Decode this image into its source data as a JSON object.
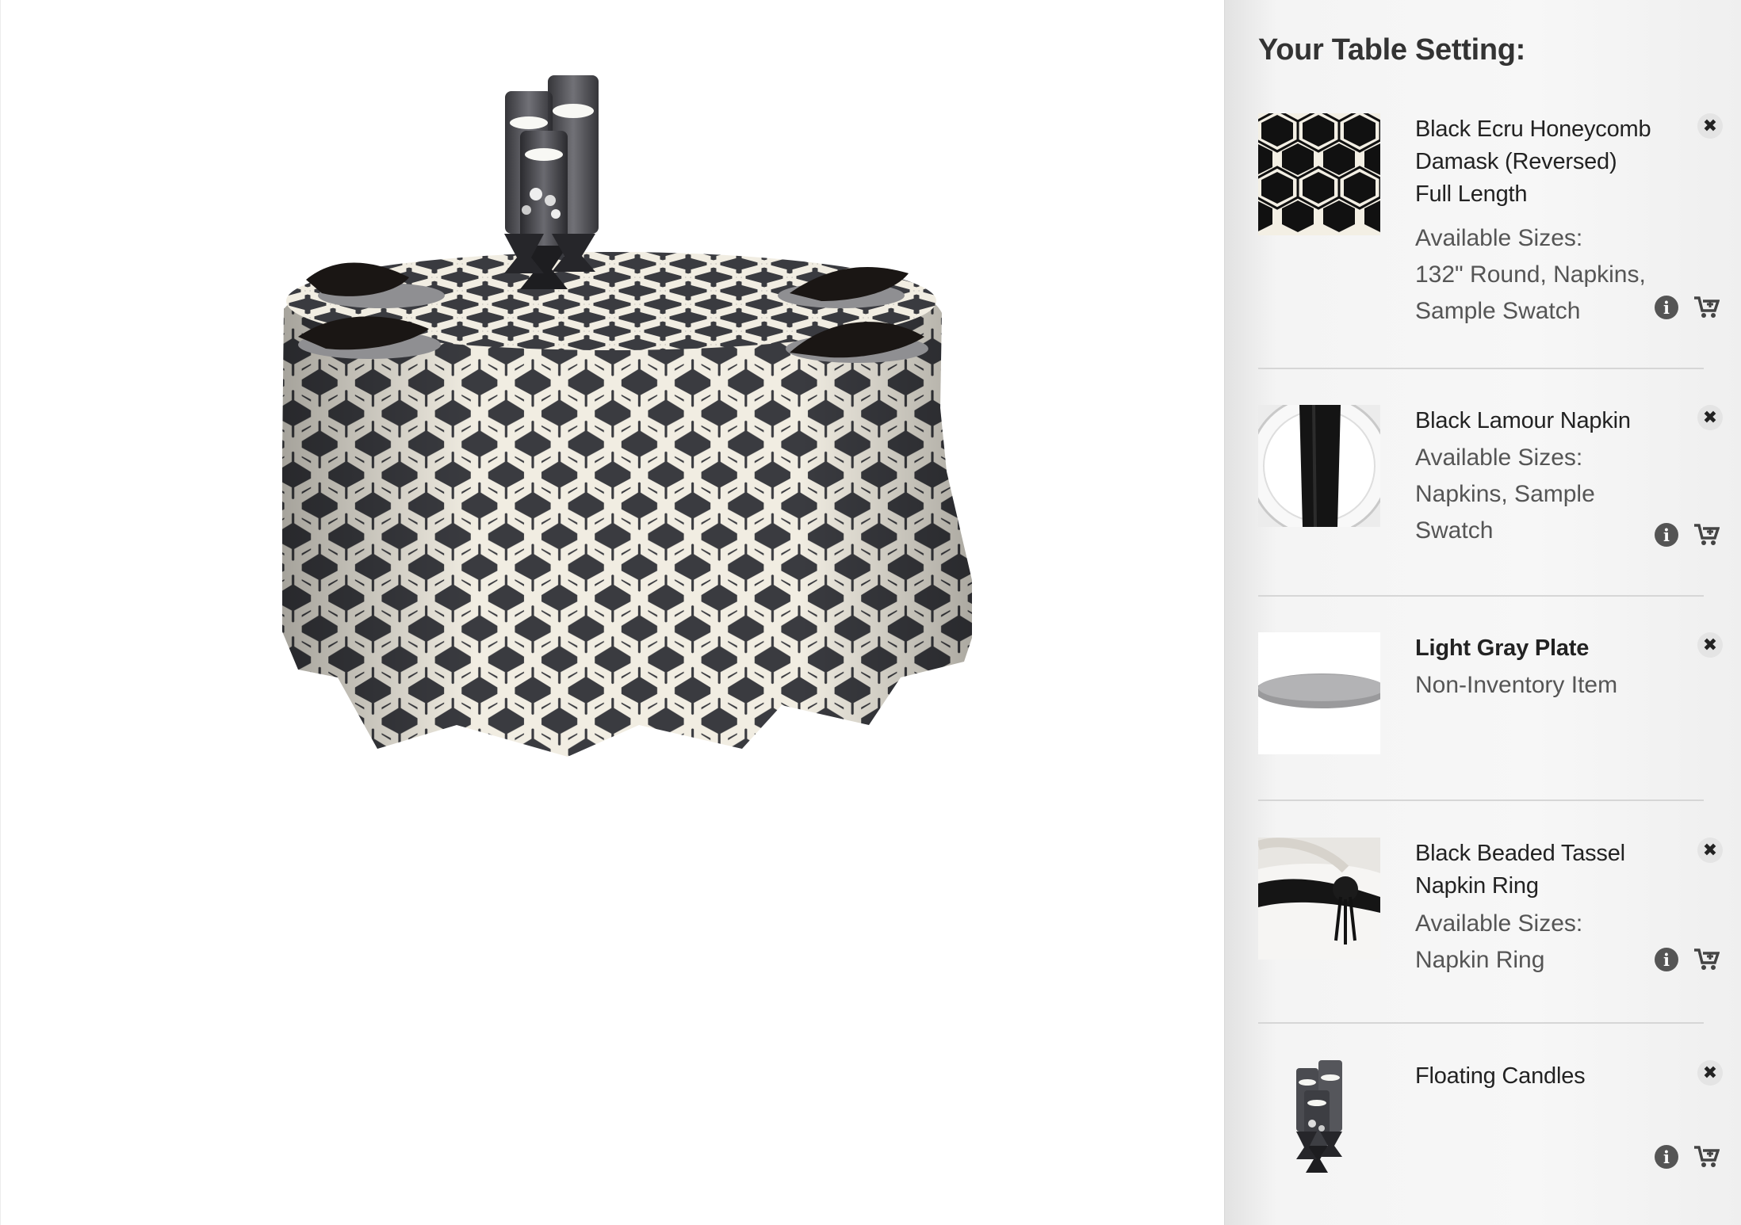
{
  "sidebar": {
    "title": "Your Table Setting:",
    "items": [
      {
        "name": "Black Ecru Honeycomb Damask (Reversed) Full Length",
        "name_lines": [
          "Black Ecru Honeycomb",
          "Damask (Reversed)",
          "Full Length"
        ],
        "sizes_lines": [
          "Available Sizes:",
          "132\" Round, Napkins,",
          "Sample Swatch"
        ],
        "thumbnail_icon": "honeycomb-fabric-swatch",
        "has_info": true,
        "has_cart": true
      },
      {
        "name": "Black Lamour Napkin",
        "name_lines": [
          "Black Lamour Napkin"
        ],
        "sizes_lines": [
          "Available Sizes:",
          "Napkins, Sample",
          "Swatch"
        ],
        "thumbnail_icon": "napkin-on-plate",
        "has_info": true,
        "has_cart": true
      },
      {
        "name": "Light Gray Plate",
        "name_lines": [
          "Light Gray Plate"
        ],
        "sizes_lines": [
          "Non-Inventory Item"
        ],
        "thumbnail_icon": "gray-plate",
        "has_info": false,
        "has_cart": false
      },
      {
        "name": "Black Beaded Tassel Napkin Ring",
        "name_lines": [
          "Black Beaded Tassel",
          "Napkin Ring"
        ],
        "sizes_lines": [
          "Available Sizes:",
          "Napkin Ring"
        ],
        "thumbnail_icon": "beaded-napkin-ring",
        "has_info": true,
        "has_cart": true
      },
      {
        "name": "Floating Candles",
        "name_lines": [
          "Floating Candles"
        ],
        "sizes_lines": [],
        "thumbnail_icon": "floating-candles",
        "has_info": true,
        "has_cart": true
      }
    ],
    "icons": {
      "remove": "close-icon",
      "info": "info-icon",
      "cart": "add-to-cart-icon"
    },
    "info_glyph": "i",
    "remove_glyph": "✖"
  },
  "colors": {
    "panel_background": "#f5f5f5",
    "title_text": "#333333",
    "fabric_dark": "#3a3b40",
    "fabric_light": "#f1ede2"
  }
}
